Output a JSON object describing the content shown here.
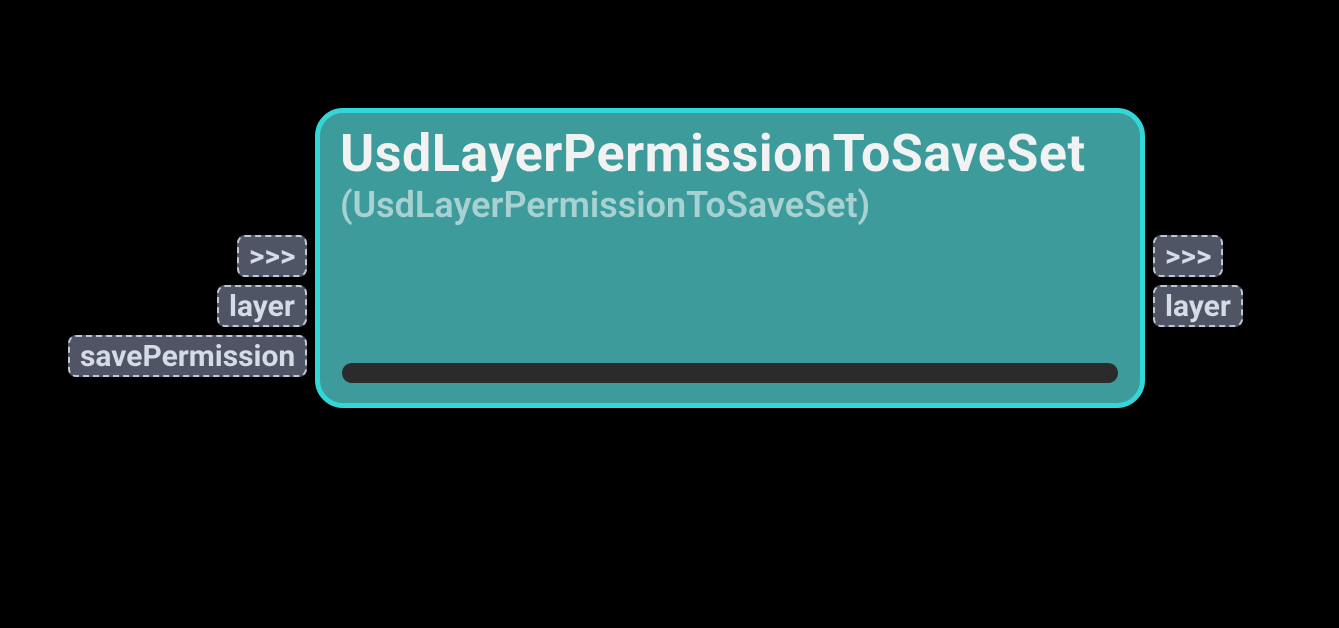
{
  "node": {
    "title": "UsdLayerPermissionToSaveSet",
    "subtitle": "(UsdLayerPermissionToSaveSet)"
  },
  "inputs": [
    {
      "label": ">>>"
    },
    {
      "label": "layer"
    },
    {
      "label": "savePermission"
    }
  ],
  "outputs": [
    {
      "label": ">>>"
    },
    {
      "label": "layer"
    }
  ],
  "colors": {
    "node_fill": "#3E9B9B",
    "node_border": "#32D7D7",
    "port_fill": "#4F5565",
    "port_border_dashed": "#bfc6d6",
    "bottom_bar": "#2B2B2B",
    "background": "#000000"
  }
}
